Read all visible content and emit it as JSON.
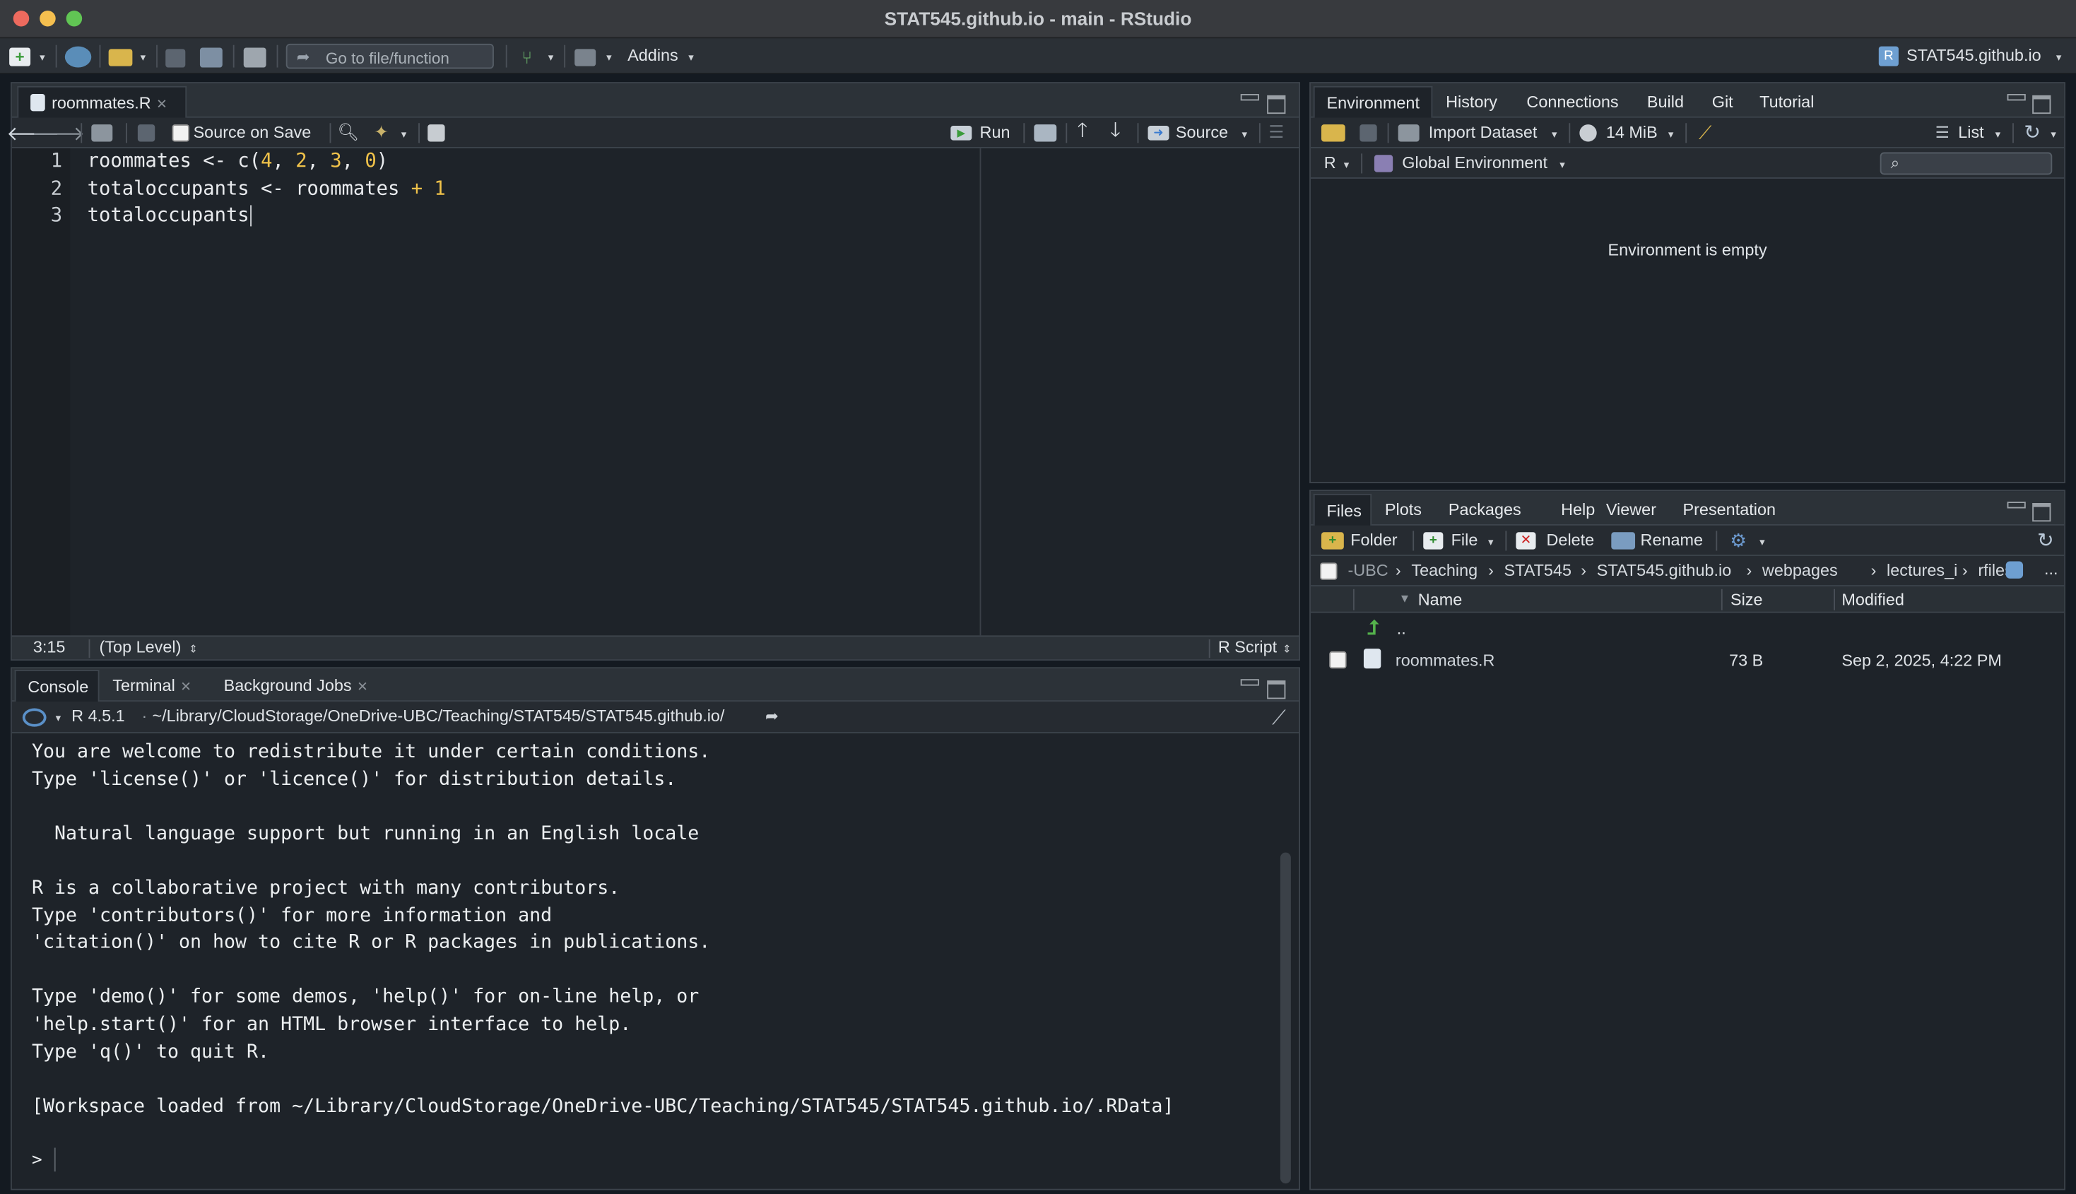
{
  "window": {
    "title": "STAT545.github.io - main - RStudio"
  },
  "main_toolbar": {
    "goto_placeholder": "Go to file/function",
    "addins_label": "Addins",
    "project_label": "STAT545.github.io"
  },
  "source_pane": {
    "tab_label": "roommates.R",
    "source_on_save_label": "Source on Save",
    "run_label": "Run",
    "source_label": "Source",
    "lines": [
      {
        "no": "1",
        "parts": [
          {
            "t": "roommates ",
            "c": "kw"
          },
          {
            "t": "<-",
            "c": "kw"
          },
          {
            "t": " c(",
            "c": "kw"
          },
          {
            "t": "4",
            "c": "num"
          },
          {
            "t": ", ",
            "c": "kw"
          },
          {
            "t": "2",
            "c": "num"
          },
          {
            "t": ", ",
            "c": "kw"
          },
          {
            "t": "3",
            "c": "num"
          },
          {
            "t": ", ",
            "c": "kw"
          },
          {
            "t": "0",
            "c": "num"
          },
          {
            "t": ")",
            "c": "kw"
          }
        ]
      },
      {
        "no": "2",
        "parts": [
          {
            "t": "totaloccupants ",
            "c": "kw"
          },
          {
            "t": "<-",
            "c": "kw"
          },
          {
            "t": " roommates ",
            "c": "kw"
          },
          {
            "t": "+",
            "c": "op"
          },
          {
            "t": " ",
            "c": "kw"
          },
          {
            "t": "1",
            "c": "num"
          }
        ]
      },
      {
        "no": "3",
        "parts": [
          {
            "t": "totaloccupants",
            "c": "kw"
          }
        ]
      }
    ],
    "status_position": "3:15",
    "status_scope": "(Top Level)",
    "status_filetype": "R Script"
  },
  "console_pane": {
    "tabs": [
      "Console",
      "Terminal",
      "Background Jobs"
    ],
    "r_version": "R 4.5.1",
    "working_dir": "~/Library/CloudStorage/OneDrive-UBC/Teaching/STAT545/STAT545.github.io/",
    "lines": [
      "You are welcome to redistribute it under certain conditions.",
      "Type 'license()' or 'licence()' for distribution details.",
      "",
      "  Natural language support but running in an English locale",
      "",
      "R is a collaborative project with many contributors.",
      "Type 'contributors()' for more information and",
      "'citation()' on how to cite R or R packages in publications.",
      "",
      "Type 'demo()' for some demos, 'help()' for on-line help, or",
      "'help.start()' for an HTML browser interface to help.",
      "Type 'q()' to quit R.",
      "",
      "[Workspace loaded from ~/Library/CloudStorage/OneDrive-UBC/Teaching/STAT545/STAT545.github.io/.RData]",
      "",
      ""
    ],
    "prompt": ">"
  },
  "env_pane": {
    "tabs": [
      "Environment",
      "History",
      "Connections",
      "Build",
      "Git",
      "Tutorial"
    ],
    "import_dataset_label": "Import Dataset",
    "memory_label": "14 MiB",
    "list_label": "List",
    "language_label": "R",
    "scope_label": "Global Environment",
    "empty_message": "Environment is empty"
  },
  "files_pane": {
    "tabs": [
      "Files",
      "Plots",
      "Packages",
      "Help",
      "Viewer",
      "Presentation"
    ],
    "folder_label": "Folder",
    "file_label": "File",
    "delete_label": "Delete",
    "rename_label": "Rename",
    "breadcrumb": [
      "-UBC",
      "Teaching",
      "STAT545",
      "STAT545.github.io",
      "webpages",
      "lectures_i",
      "rfiles"
    ],
    "more_label": "...",
    "columns": {
      "name": "Name",
      "size": "Size",
      "modified": "Modified"
    },
    "parent_label": "..",
    "rows": [
      {
        "name": "roommates.R",
        "size": "73 B",
        "modified": "Sep 2, 2025, 4:22 PM"
      }
    ]
  },
  "colors": {
    "accent_blue": "#4a90d9",
    "number_yellow": "#f0c24a",
    "background": "#1e2329"
  }
}
